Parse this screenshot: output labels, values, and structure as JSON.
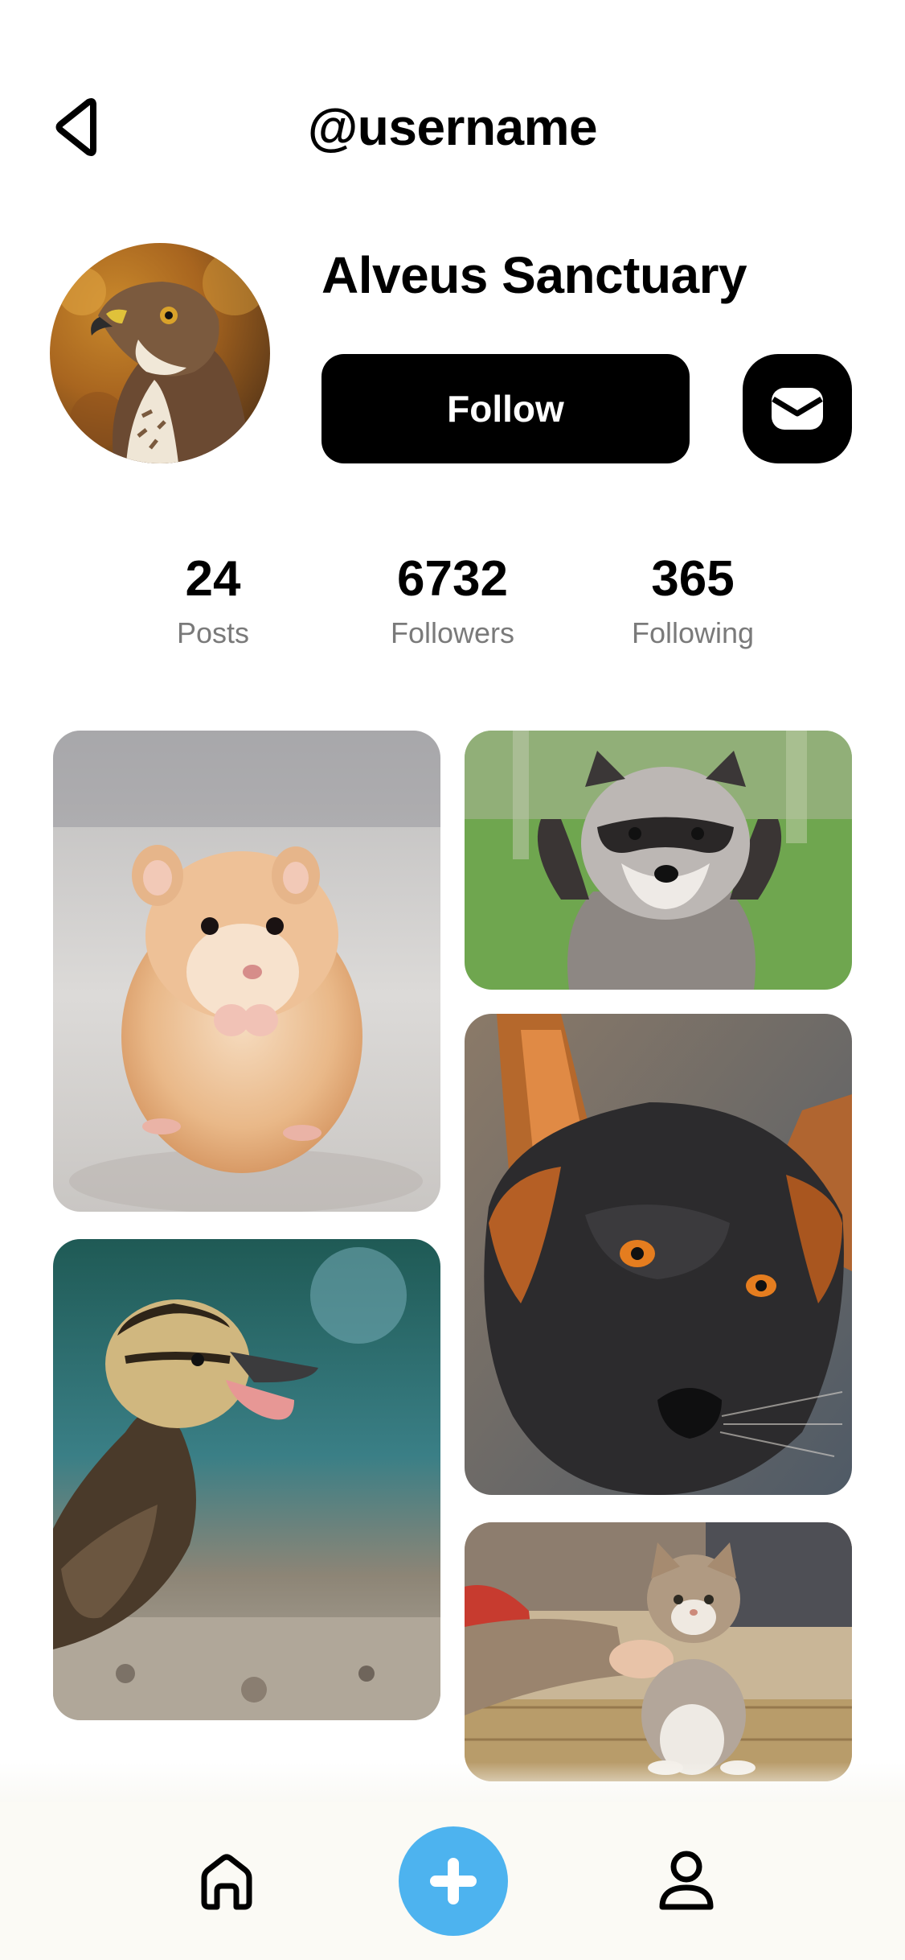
{
  "header": {
    "title": "@username",
    "back_icon": "back-triangle-icon"
  },
  "profile": {
    "display_name": "Alveus Sanctuary",
    "follow_label": "Follow",
    "message_icon": "envelope-icon",
    "avatar_subject": "hawk"
  },
  "stats": [
    {
      "value": "24",
      "label": "Posts"
    },
    {
      "value": "6732",
      "label": "Followers"
    },
    {
      "value": "365",
      "label": "Following"
    }
  ],
  "grid": {
    "tiles": [
      "hamster",
      "raccoon",
      "fox",
      "duckling",
      "kitten"
    ]
  },
  "bottom_nav": {
    "items": [
      {
        "icon": "home-icon"
      },
      {
        "icon": "plus-icon"
      },
      {
        "icon": "person-icon"
      }
    ],
    "accent": "#4db3ef"
  },
  "colors": {
    "primary": "#000000",
    "secondary_text": "#7a7a7a",
    "nav_background": "#fbfaf5"
  }
}
